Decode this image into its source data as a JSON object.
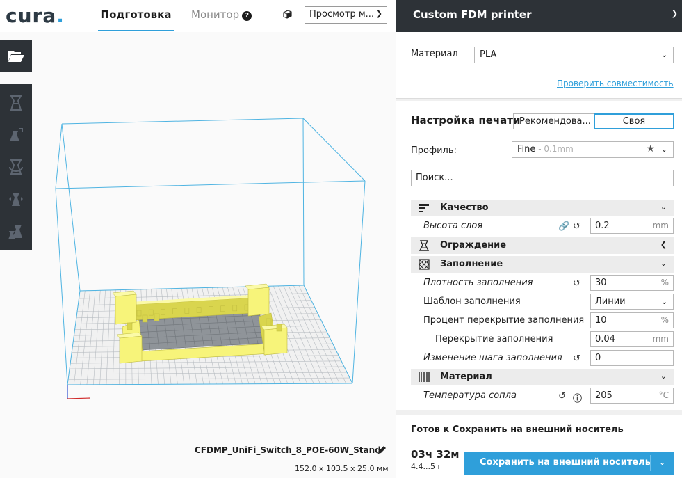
{
  "app": {
    "logo": "cura",
    "logo_dot": ".",
    "accent": "#2f9fda",
    "dark": "#2d3237"
  },
  "header": {
    "tabs": [
      {
        "label": "Подготовка",
        "active": true
      },
      {
        "label": "Монитор",
        "active": false
      }
    ],
    "help_glyph": "?",
    "view_mode": "Просмотр м..."
  },
  "toolbar": {
    "tools": [
      "open-file-icon",
      "move-icon",
      "scale-icon",
      "rotate-icon",
      "mirror-icon",
      "per-model-settings-icon"
    ]
  },
  "viewport": {
    "object_name": "CFDMP_UniFi_Switch_8_POE-60W_Stand",
    "dimensions": "152.0 x 103.5 x 25.0 мм"
  },
  "panel": {
    "printer_name": "Custom FDM printer",
    "material_label": "Материал",
    "material_value": "PLA",
    "compat_link": "Проверить совместимость",
    "print_setup_title": "Настройка печати",
    "mode_recommended": "Рекомендова...",
    "mode_custom": "Своя",
    "profile_label": "Профиль:",
    "profile_value": "Fine",
    "profile_detail": " - 0.1mm",
    "search_placeholder": "Поиск...",
    "categories": {
      "quality": "Качество",
      "shell": "Ограждение",
      "infill": "Заполнение",
      "material": "Материал"
    },
    "settings": {
      "layer_height": {
        "label": "Высота слоя",
        "value": "0.2",
        "unit": "mm"
      },
      "infill_density": {
        "label": "Плотность заполнения",
        "value": "30",
        "unit": "%"
      },
      "infill_pattern": {
        "label": "Шаблон заполнения",
        "value": "Линии"
      },
      "infill_overlap": {
        "label": "Процент перекрытие заполнения",
        "value": "10",
        "unit": "%"
      },
      "infill_overlap_mm": {
        "label": "Перекрытие заполнения",
        "value": "0.04",
        "unit": "mm"
      },
      "gradual_infill": {
        "label": "Изменение шага заполнения",
        "value": "0"
      },
      "nozzle_temp": {
        "label": "Температура сопла",
        "value": "205",
        "unit": "°C"
      }
    },
    "action": {
      "ready": "Готов к Сохранить на внешний носитель",
      "time": "03ч 32м",
      "weight": "4.4...5 г",
      "save_button": "Сохранить на внешний носитель"
    }
  }
}
